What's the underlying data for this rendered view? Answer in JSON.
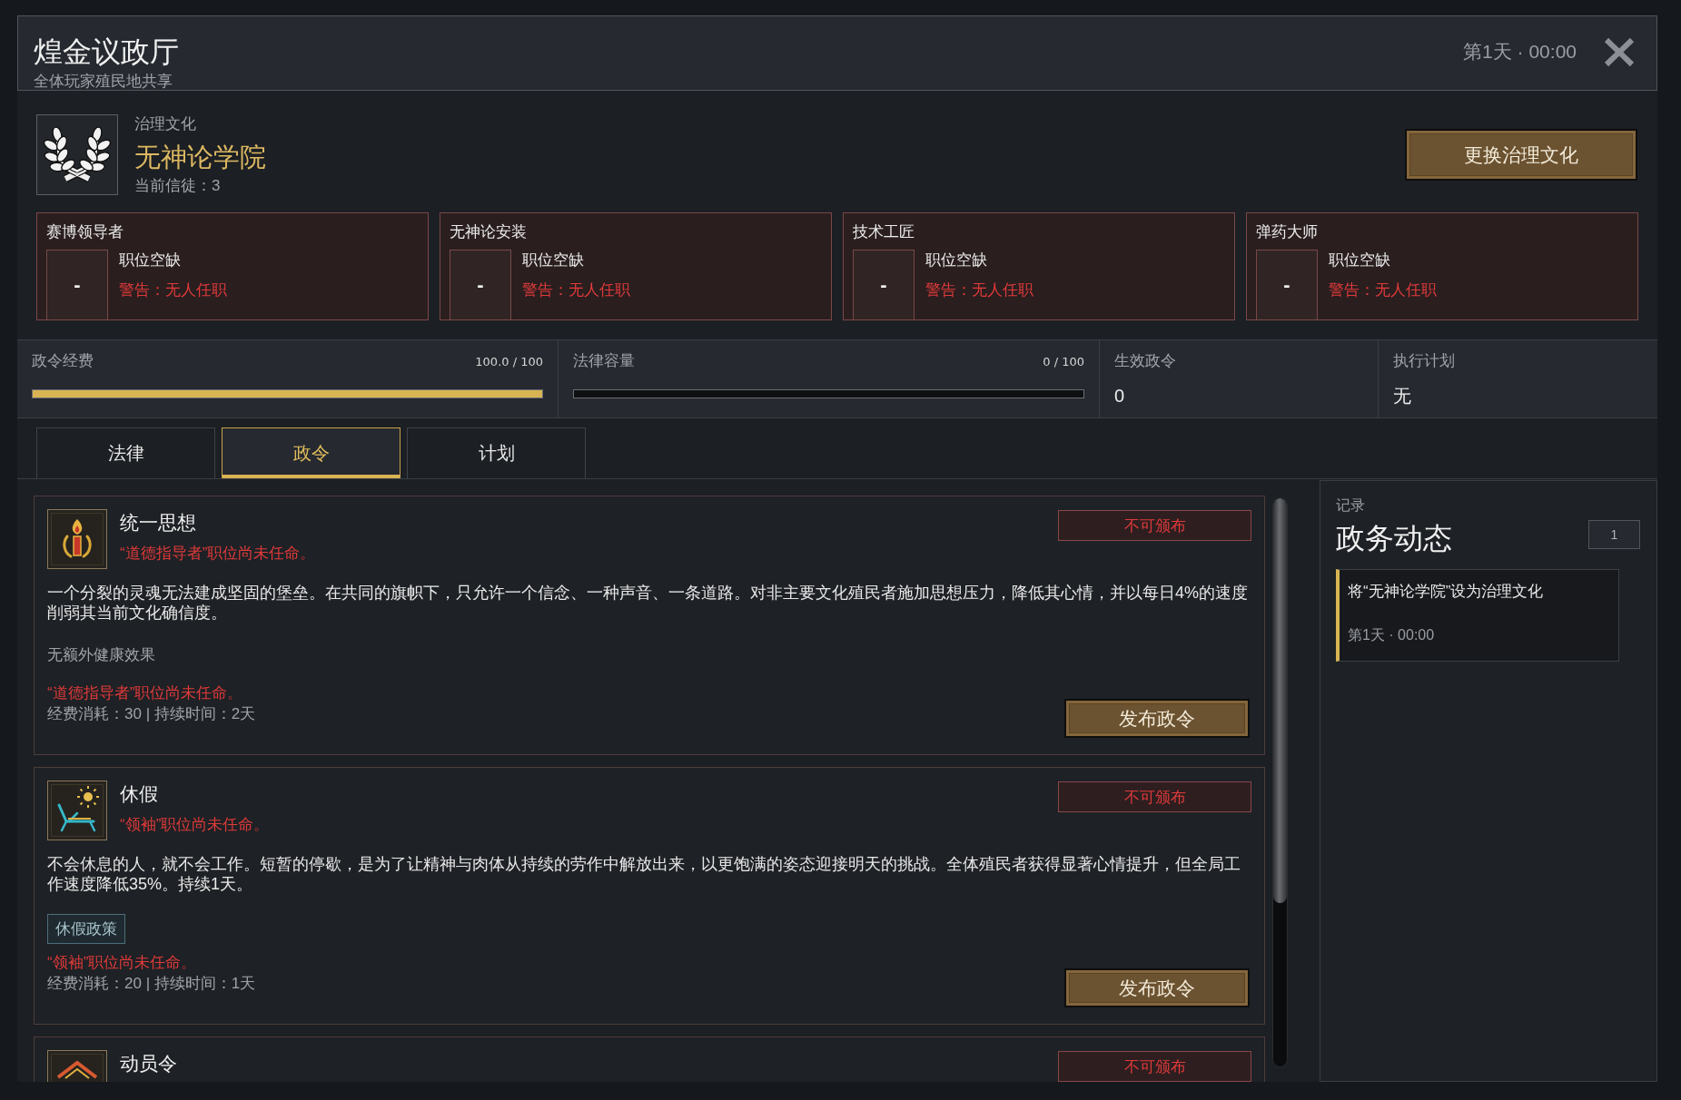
{
  "window": {
    "title": "煌金议政厅",
    "subtitle": "全体玩家殖民地共享",
    "clock": "第1天 · 00:00"
  },
  "culture": {
    "label": "治理文化",
    "name": "无神论学院",
    "followers": "当前信徒：3",
    "change_button": "更换治理文化"
  },
  "positions": [
    {
      "title": "赛博领导者",
      "slot": "-",
      "status": "职位空缺",
      "warning": "警告：无人任职",
      "vacant": true
    },
    {
      "title": "无神论安装",
      "slot": "-",
      "status": "职位空缺",
      "warning": "警告：无人任职",
      "vacant": true
    },
    {
      "title": "技术工匠",
      "slot": "-",
      "status": "职位空缺",
      "warning": "警告：无人任职",
      "vacant": true
    },
    {
      "title": "弹药大师",
      "slot": "-",
      "status": "职位空缺",
      "warning": "警告：无人任职",
      "vacant": true
    }
  ],
  "stats": [
    {
      "kind": "meter",
      "label": "政令经费",
      "reading": "100.0 / 100",
      "level": 1
    },
    {
      "kind": "meter",
      "label": "法律容量",
      "reading": "0 / 100",
      "level": 0
    },
    {
      "kind": "value",
      "label": "生效政令",
      "value": "0"
    },
    {
      "kind": "value",
      "label": "执行计划",
      "value": "无"
    }
  ],
  "tabs": [
    {
      "label": "法律",
      "selected": false
    },
    {
      "label": "政令",
      "selected": true
    },
    {
      "label": "计划",
      "selected": false
    }
  ],
  "decrees": [
    {
      "title": "统一思想",
      "requirement": "“道德指导者”职位尚未任命。",
      "status": "不可颁布",
      "description": "一个分裂的灵魂无法建成坚固的堡垒。在共同的旗帜下，只允许一个信念、一种声音、一条道路。对非主要文化殖民者施加思想压力，降低其心情，并以每日4%的速度削弱其当前文化确信度。",
      "effect": {
        "kind": "note",
        "text": "无额外健康效果"
      },
      "note": "“道德指导者”职位尚未任命。",
      "cost": "经费消耗：30 | 持续时间：2天",
      "button": "发布政令"
    },
    {
      "title": "休假",
      "requirement": "“领袖”职位尚未任命。",
      "status": "不可颁布",
      "description": "不会休息的人，就不会工作。短暂的停歇，是为了让精神与肉体从持续的劳作中解放出来，以更饱满的姿态迎接明天的挑战。全体殖民者获得显著心情提升，但全局工作速度降低35%。持续1天。",
      "effect": {
        "kind": "tag",
        "text": "休假政策"
      },
      "note": "“领袖”职位尚未任命。",
      "cost": "经费消耗：20 | 持续时间：1天",
      "button": "发布政令"
    },
    {
      "title": "动员令",
      "status": "不可颁布"
    }
  ],
  "log": {
    "label": "记录",
    "title": "政务动态",
    "count": "1",
    "entries": [
      {
        "text": "将“无神论学院”设为治理文化",
        "time": "第1天 · 00:00"
      }
    ]
  }
}
